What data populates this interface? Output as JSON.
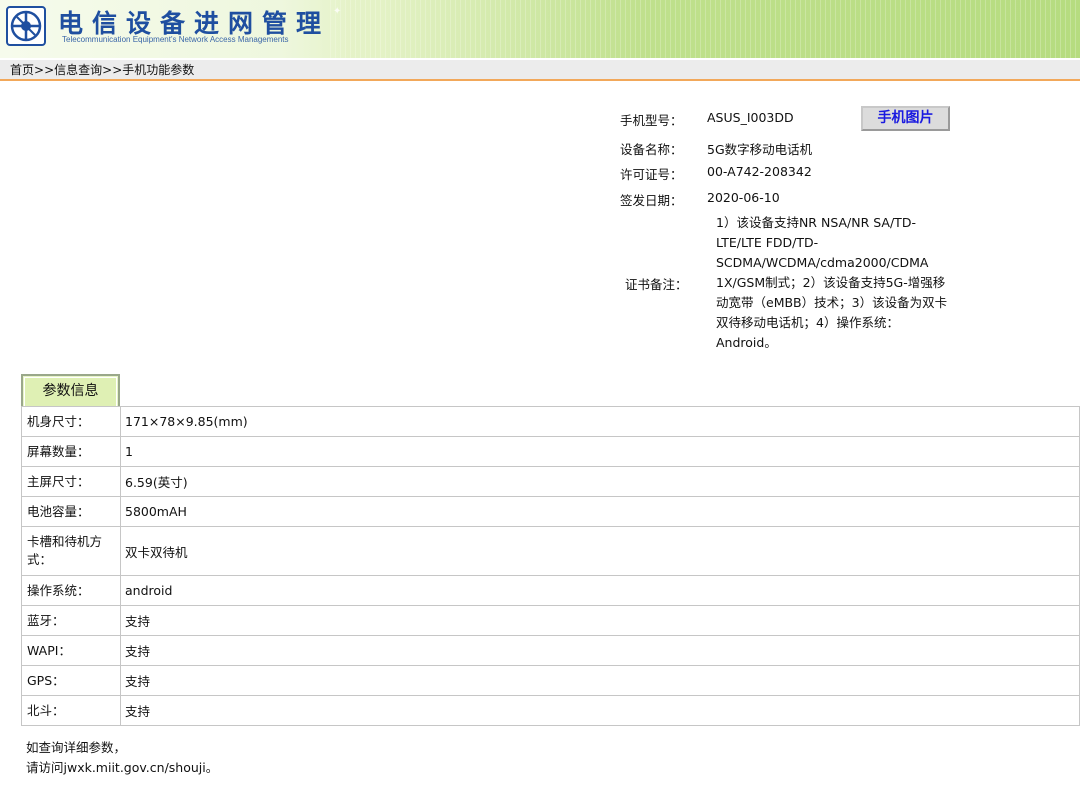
{
  "header": {
    "title": "电信设备进网管理",
    "subtitle": "Telecommunication Equipment's Network Access Managements"
  },
  "breadcrumb": {
    "home": "首页",
    "sep1": ">>",
    "info_query": "信息查询",
    "sep2": ">>",
    "current": "手机功能参数"
  },
  "device": {
    "model_label": "手机型号：",
    "model_value": "ASUS_I003DD",
    "photo_button": "手机图片",
    "name_label": "设备名称：",
    "name_value": "5G数字移动电话机",
    "license_label": "许可证号：",
    "license_value": "00-A742-208342",
    "date_label": "签发日期：",
    "date_value": "2020-06-10",
    "remark_label": "证书备注：",
    "remark_value": "1）该设备支持NR NSA/NR SA/TD-LTE/LTE FDD/TD-SCDMA/WCDMA/cdma2000/CDMA 1X/GSM制式；2）该设备支持5G-增强移动宽带（eMBB）技术；3）该设备为双卡双待移动电话机；4）操作系统：Android。"
  },
  "params": {
    "tab_label": "参数信息",
    "rows": [
      {
        "key": "机身尺寸：",
        "value": "171×78×9.85(mm)"
      },
      {
        "key": "屏幕数量：",
        "value": "1"
      },
      {
        "key": "主屏尺寸：",
        "value": "6.59(英寸)"
      },
      {
        "key": "电池容量：",
        "value": "5800mAH"
      },
      {
        "key": "卡槽和待机方式：",
        "value": "双卡双待机"
      },
      {
        "key": "操作系统：",
        "value": "android"
      },
      {
        "key": "蓝牙：",
        "value": "支持"
      },
      {
        "key": "WAPI：",
        "value": "支持"
      },
      {
        "key": "GPS：",
        "value": "支持"
      },
      {
        "key": "北斗：",
        "value": "支持"
      }
    ]
  },
  "footer": {
    "line1": "如查询详细参数，",
    "line2": "请访问jwxk.miit.gov.cn/shouji。"
  },
  "colors": {
    "title_blue": "#1f4fa0",
    "banner_green": "#b6dc80",
    "breadcrumb_border": "#f2a85a",
    "photo_button_text": "#1a1ae0",
    "tab_bg": "#dff0b4"
  }
}
